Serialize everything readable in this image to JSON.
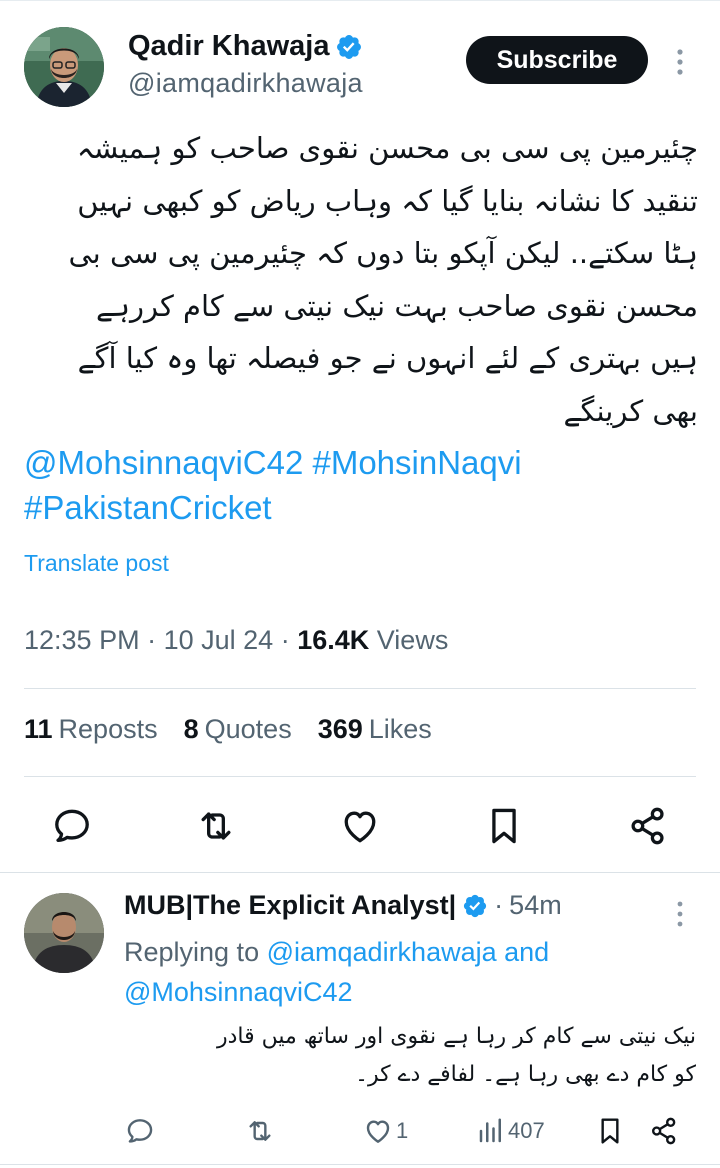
{
  "tweet": {
    "author_name": "Qadir Khawaja",
    "author_handle": "@iamqadirkhawaja",
    "subscribe_label": "Subscribe",
    "body_lines": [
      "چئیرمین پی سی بی محسن نقوی صاحب کو ہمیشہ",
      "تنقید کا نشانہ بنایا گیا کہ وہاب ریاض کو کبھی نہیں",
      "ہٹا سکتے.. لیکن آپکو بتا دوں کہ چئیرمین پی سی بی",
      "محسن نقوی صاحب بہت نیک نیتی سے کام کررہے",
      "ہیں بہتری کے لئے انہوں نے جو فیصلہ تھا وہ کیا آگے",
      "بھی کرینگے"
    ],
    "hashtags": [
      "@MohsinnaqviC42",
      "#MohsinNaqvi",
      "#PakistanCricket"
    ],
    "translate_label": "Translate post",
    "time": "12:35 PM",
    "date": "10 Jul 24",
    "views_count": "16.4K",
    "views_label": "Views",
    "reposts_count": "11",
    "reposts_label": "Reposts",
    "quotes_count": "8",
    "quotes_label": "Quotes",
    "likes_count": "369",
    "likes_label": "Likes"
  },
  "reply": {
    "author_name": "MUB|The Explicit Analyst|",
    "time": "54m",
    "replying_prefix": "Replying to",
    "mention_1": "@iamqadirkhawaja",
    "and_word": "and",
    "mention_2": "@MohsinnaqviC42",
    "body_lines": [
      "نیک نیتی سے کام کر رہا ہے نقوی اور ساتھ میں قادر",
      "کو کام دے بھی رہا ہے۔ لفافے دے کر۔"
    ],
    "likes_count": "1",
    "views_count": "407"
  },
  "icons": {
    "verified": "verified-badge-icon",
    "more": "more-vertical-icon",
    "reply": "reply-icon",
    "repost": "repost-icon",
    "like": "like-icon",
    "bookmark": "bookmark-icon",
    "share": "share-icon",
    "views": "views-icon"
  },
  "colors": {
    "accent": "#1d9bf0",
    "text": "#0f1419",
    "muted": "#536471",
    "divider": "#dbe2e7"
  }
}
